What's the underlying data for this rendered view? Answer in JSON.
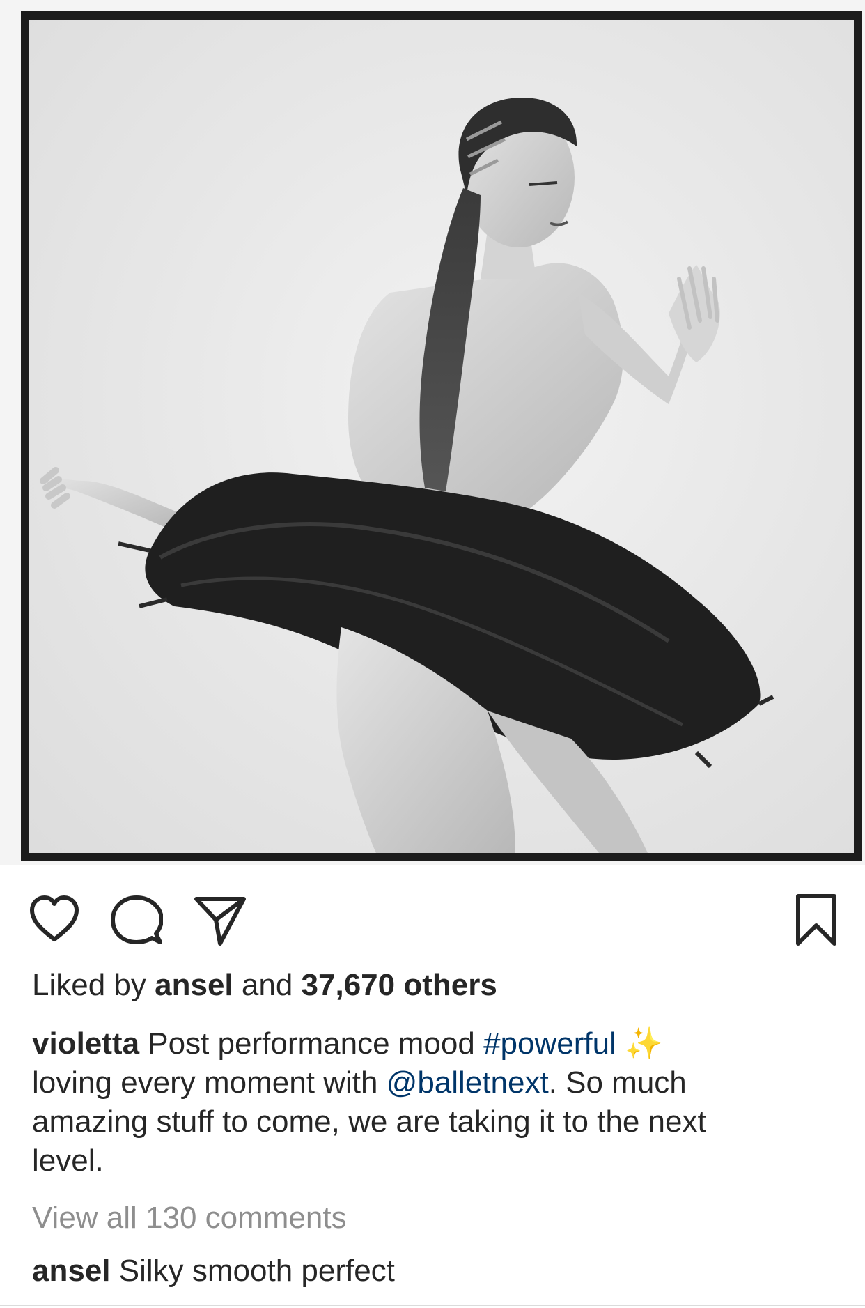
{
  "post": {
    "image_alt": "Black and white film photo of a ballet dancer in a black tutu posing against a white wall",
    "likes": {
      "prefix": "Liked by",
      "user": "ansel",
      "conjunction": "and",
      "others": "37,670 others"
    },
    "caption": {
      "username": "violetta",
      "line1_text": "Post performance mood",
      "hashtag": "#powerful",
      "emoji": "✨",
      "line2_prefix": "loving every moment with",
      "mention": "@balletnext",
      "line2_suffix": ". So much",
      "line3": "amazing stuff to come, we are taking it to the next",
      "line4": "level."
    },
    "view_comments": "View all 130 comments",
    "top_comment": {
      "username": "ansel",
      "text": "Silky smooth perfect"
    }
  },
  "icons": {
    "like": "heart-icon",
    "comment": "speech-bubble-icon",
    "share": "paper-plane-icon",
    "save": "bookmark-icon"
  },
  "colors": {
    "text": "#262626",
    "link": "#003569",
    "muted": "#8e8e8e",
    "film_border": "#1a1a1a",
    "sparkle": "#e9c46a"
  }
}
